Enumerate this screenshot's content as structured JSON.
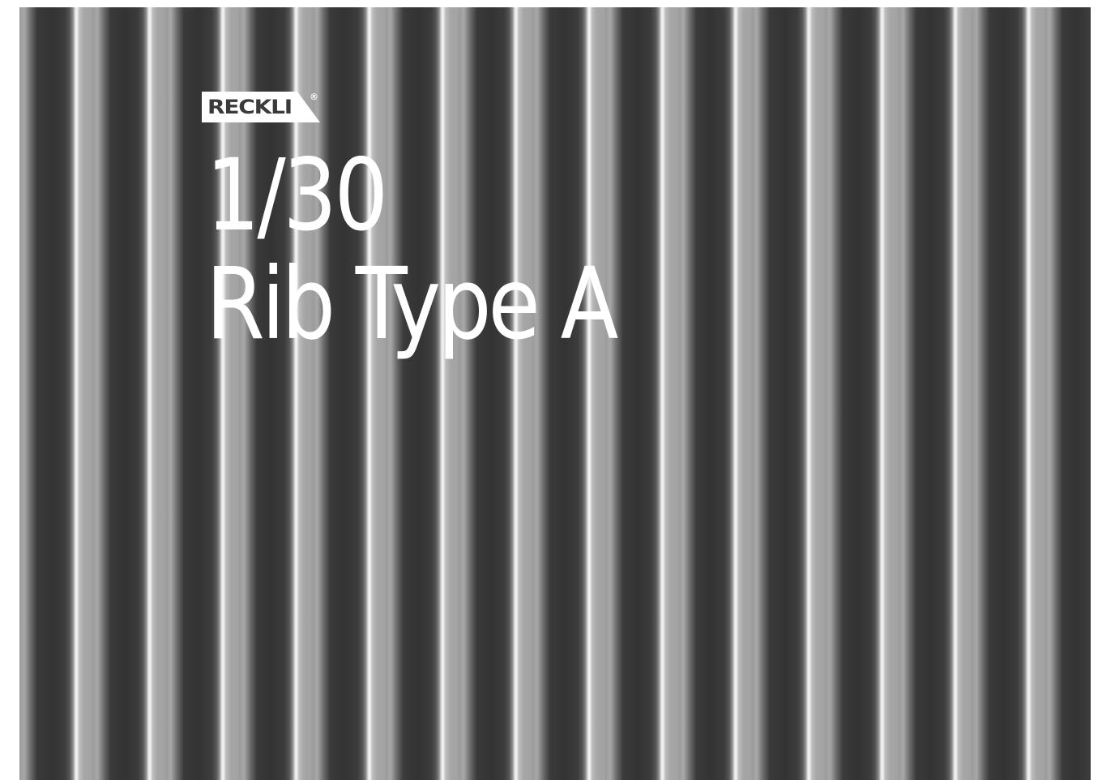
{
  "brand": {
    "logo_text": "RECKLI",
    "registered_mark": "®"
  },
  "title": {
    "line1": "1/30",
    "line2": "Rib Type A"
  },
  "colors": {
    "rib_dark": "#333333",
    "rib_light": "#a6a6a6",
    "rib_highlight": "#f4f4f4",
    "text": "#ffffff"
  }
}
